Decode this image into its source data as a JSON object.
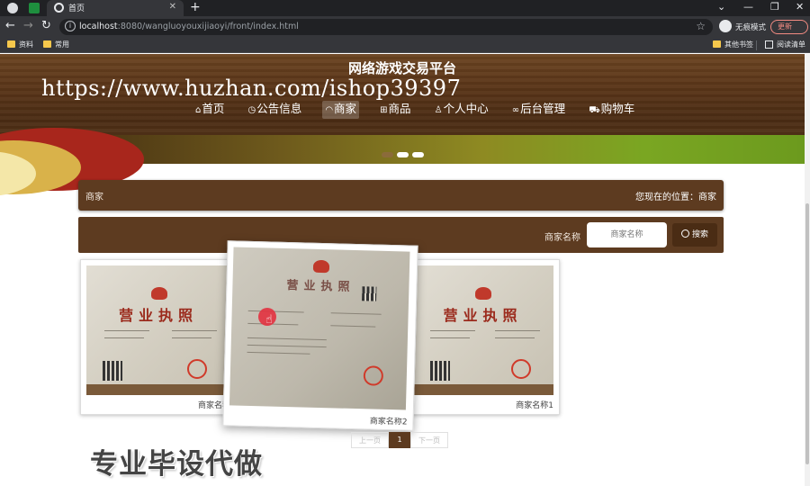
{
  "browser": {
    "tab_title": "首页",
    "url_host": "localhost",
    "url_rest": ":8080/wangluoyouxijiaoyi/front/index.html",
    "incognito_label": "无痕模式",
    "update_label": "更新",
    "bookmarks": [
      "资料",
      "常用"
    ],
    "bookmarks_right": [
      "其他书签",
      "阅读清单"
    ]
  },
  "site": {
    "title": "网络游戏交易平台",
    "watermark": "https://www.huzhan.com/ishop39397",
    "nav": [
      {
        "label": "首页",
        "icon": "home-icon",
        "active": false
      },
      {
        "label": "公告信息",
        "icon": "clock-icon",
        "active": false
      },
      {
        "label": "商家",
        "icon": "shop-icon",
        "active": true
      },
      {
        "label": "商品",
        "icon": "goods-icon",
        "active": false
      },
      {
        "label": "个人中心",
        "icon": "user-icon",
        "active": false
      },
      {
        "label": "后台管理",
        "icon": "link-icon",
        "active": false
      },
      {
        "label": "购物车",
        "icon": "cart-icon",
        "active": false
      }
    ],
    "carousel": {
      "slide_count": 3
    }
  },
  "section": {
    "title": "商家",
    "location": "您现在的位置：商家"
  },
  "search": {
    "label": "商家名称",
    "placeholder": "商家名称",
    "button_label": "搜索"
  },
  "merchants": [
    {
      "name": "商家名称",
      "image": "business-license"
    },
    {
      "name": "商家名称2",
      "image": "business-license"
    },
    {
      "name": "商家名称1",
      "image": "business-license"
    }
  ],
  "pager": {
    "prev": "上一页",
    "current": "1",
    "next": "下一页"
  },
  "promo": "专业毕设代做",
  "colors": {
    "brand_brown": "#5d3b20",
    "accent_red": "#e2313f"
  }
}
